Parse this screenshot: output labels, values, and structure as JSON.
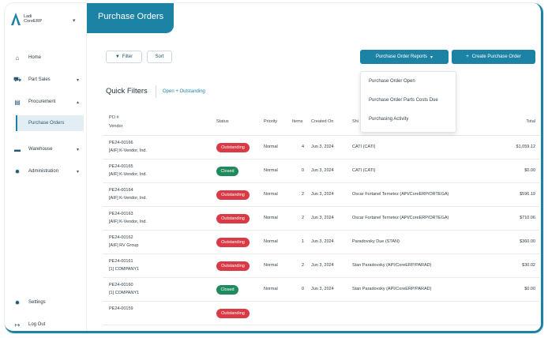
{
  "app": {
    "logo_text_line1": "Ladi",
    "logo_text_line2": "CoreERP",
    "page_title": "Purchase Orders"
  },
  "sidebar": {
    "items": [
      {
        "label": "Home",
        "icon": "home-icon",
        "glyph": "⌂"
      },
      {
        "label": "Part Sales",
        "icon": "cart-icon",
        "glyph": "⛟"
      },
      {
        "label": "Procurement",
        "icon": "clipboard-icon",
        "glyph": "▤"
      },
      {
        "label": "Warehouse",
        "icon": "truck-icon",
        "glyph": "▬"
      },
      {
        "label": "Administration",
        "icon": "gear-icon",
        "glyph": "✹"
      }
    ],
    "sub_item": "Purchase Orders",
    "bottom": [
      {
        "label": "Settings",
        "icon": "gear-icon",
        "glyph": "✹"
      },
      {
        "label": "Log Out",
        "icon": "logout-icon",
        "glyph": "↦"
      }
    ]
  },
  "toolbar": {
    "filter_label": "Filter",
    "sort_label": "Sort",
    "reports_label": "Purchase Order Reports",
    "create_label": "Create Purchase Order"
  },
  "reports_menu": [
    "Purchase Order Open",
    "Purchase Order Parts Costs Due",
    "Purchasing Activity"
  ],
  "quick_filters": {
    "title": "Quick Filters",
    "link": "Open + Outstanding"
  },
  "table": {
    "headers": {
      "po": "PO #",
      "vendor": "Vendor",
      "status": "Status",
      "priority": "Priority",
      "items": "Items",
      "created": "Created On",
      "ship": "Shi",
      "total": "Total"
    },
    "rows": [
      {
        "po": "PE24-00166",
        "vendor": "[AIF] K-Vendor, Ind.",
        "status": "Outstanding",
        "kind": "out",
        "priority": "Normal",
        "items": "4",
        "created": "Jun 3, 2024",
        "ship": "CATI (CATI)",
        "total": "$1,059.12"
      },
      {
        "po": "PE24-00165",
        "vendor": "[AIF] K-Vendor, Ind.",
        "status": "Closed",
        "kind": "closed",
        "priority": "Normal",
        "items": "0",
        "created": "Jun 3, 2024",
        "ship": "CATI (CATI)",
        "total": "$0.00"
      },
      {
        "po": "PE24-00164",
        "vendor": "[AIF] K-Vendor, Ind.",
        "status": "Outstanding",
        "kind": "out",
        "priority": "Normal",
        "items": "2",
        "created": "Jun 3, 2024",
        "ship": "Oscar Fortanel Ternetez (API/CoreERP/ORTEGA)",
        "total": "$596.19"
      },
      {
        "po": "PE24-00163",
        "vendor": "[AIF] K-Vendor, Ind.",
        "status": "Outstanding",
        "kind": "out",
        "priority": "Normal",
        "items": "2",
        "created": "Jun 3, 2024",
        "ship": "Oscar Fortanel Ternetez (API/CoreERP/ORTEGA)",
        "total": "$710.06"
      },
      {
        "po": "PE24-00162",
        "vendor": "[AIF] RV Group",
        "status": "Outstanding",
        "kind": "out",
        "priority": "Normal",
        "items": "1",
        "created": "Jun 3, 2024",
        "ship": "Paradovsky Due (STAN)",
        "total": "$360.00"
      },
      {
        "po": "PE24-00161",
        "vendor": "[1] COMPANY1",
        "status": "Outstanding",
        "kind": "out",
        "priority": "Normal",
        "items": "2",
        "created": "Jun 3, 2024",
        "ship": "Stan Paradovsky (API/CoreERP/PARAD)",
        "total": "$30.02"
      },
      {
        "po": "PE24-00160",
        "vendor": "[1] COMPANY1",
        "status": "Closed",
        "kind": "closed",
        "priority": "Normal",
        "items": "0",
        "created": "Jun 3, 2024",
        "ship": "Stan Paradovsky (API/CoreERP/PARAD)",
        "total": "$0.00"
      },
      {
        "po": "PE24-00159",
        "vendor": "",
        "status": "Outstanding",
        "kind": "out",
        "priority": "",
        "items": "",
        "created": "",
        "ship": "",
        "total": ""
      }
    ]
  },
  "colors": {
    "accent": "#1d83a5",
    "outstanding": "#d93a45",
    "closed": "#1f8a5c"
  }
}
